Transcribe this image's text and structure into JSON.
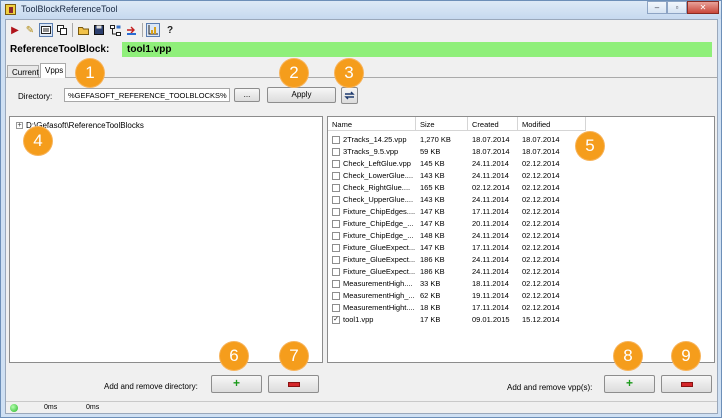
{
  "window": {
    "title": "ToolBlockReferenceTool"
  },
  "toolbar": {
    "icons": [
      "run-icon",
      "edit-icon",
      "display-icon",
      "copy-icon",
      "open-folder-icon",
      "save-icon",
      "network-icon",
      "import-icon",
      "chart-icon",
      "help-icon"
    ]
  },
  "reference": {
    "label": "ReferenceToolBlock:",
    "value": "tool1.vpp"
  },
  "tabs": [
    {
      "label": "Current"
    },
    {
      "label": "Vpps"
    }
  ],
  "directory": {
    "label": "Directory:",
    "value": "%GEFASOFT_REFERENCE_TOOLBLOCKS%",
    "browse_label": "...",
    "apply_label": "Apply"
  },
  "tree": {
    "root_label": "D:\\Gefasoft\\ReferenceToolBlocks",
    "expander": "+"
  },
  "file_table": {
    "columns": [
      "Name",
      "Size",
      "Created",
      "Modified"
    ],
    "rows": [
      {
        "checked": false,
        "name": "2Tracks_14.25.vpp",
        "size": "1,270 KB",
        "created": "18.07.2014",
        "modified": "18.07.2014"
      },
      {
        "checked": false,
        "name": "3Tracks_9.5.vpp",
        "size": "59 KB",
        "created": "18.07.2014",
        "modified": "18.07.2014"
      },
      {
        "checked": false,
        "name": "Check_LeftGlue.vpp",
        "size": "145 KB",
        "created": "24.11.2014",
        "modified": "02.12.2014"
      },
      {
        "checked": false,
        "name": "Check_LowerGlue....",
        "size": "143 KB",
        "created": "24.11.2014",
        "modified": "02.12.2014"
      },
      {
        "checked": false,
        "name": "Check_RightGlue....",
        "size": "165 KB",
        "created": "02.12.2014",
        "modified": "02.12.2014"
      },
      {
        "checked": false,
        "name": "Check_UpperGlue....",
        "size": "143 KB",
        "created": "24.11.2014",
        "modified": "02.12.2014"
      },
      {
        "checked": false,
        "name": "Fixture_ChipEdges....",
        "size": "147 KB",
        "created": "17.11.2014",
        "modified": "02.12.2014"
      },
      {
        "checked": false,
        "name": "Fixture_ChipEdge_...",
        "size": "147 KB",
        "created": "20.11.2014",
        "modified": "02.12.2014"
      },
      {
        "checked": false,
        "name": "Fixture_ChipEdge_...",
        "size": "148 KB",
        "created": "24.11.2014",
        "modified": "02.12.2014"
      },
      {
        "checked": false,
        "name": "Fixture_GlueExpect...",
        "size": "147 KB",
        "created": "17.11.2014",
        "modified": "02.12.2014"
      },
      {
        "checked": false,
        "name": "Fixture_GlueExpect...",
        "size": "186 KB",
        "created": "24.11.2014",
        "modified": "02.12.2014"
      },
      {
        "checked": false,
        "name": "Fixture_GlueExpect...",
        "size": "186 KB",
        "created": "24.11.2014",
        "modified": "02.12.2014"
      },
      {
        "checked": false,
        "name": "MeasurementHigh....",
        "size": "33 KB",
        "created": "18.11.2014",
        "modified": "02.12.2014"
      },
      {
        "checked": false,
        "name": "MeasurementHigh_...",
        "size": "62 KB",
        "created": "19.11.2014",
        "modified": "02.12.2014"
      },
      {
        "checked": false,
        "name": "MeasurementHight....",
        "size": "18 KB",
        "created": "17.11.2014",
        "modified": "02.12.2014"
      },
      {
        "checked": true,
        "name": "tool1.vpp",
        "size": "17 KB",
        "created": "09.01.2015",
        "modified": "15.12.2014"
      }
    ]
  },
  "footer": {
    "dir_label": "Add and remove directory:",
    "vpp_label": "Add and remove vpp(s):"
  },
  "status": {
    "time1": "0ms",
    "time2": "0ms"
  },
  "badges": [
    "1",
    "2",
    "3",
    "4",
    "5",
    "6",
    "7",
    "8",
    "9"
  ],
  "colors": {
    "reference_highlight": "#8fef7a",
    "badge": "#f59d1c",
    "add": "#1c9a1c",
    "remove": "#d4262a"
  }
}
